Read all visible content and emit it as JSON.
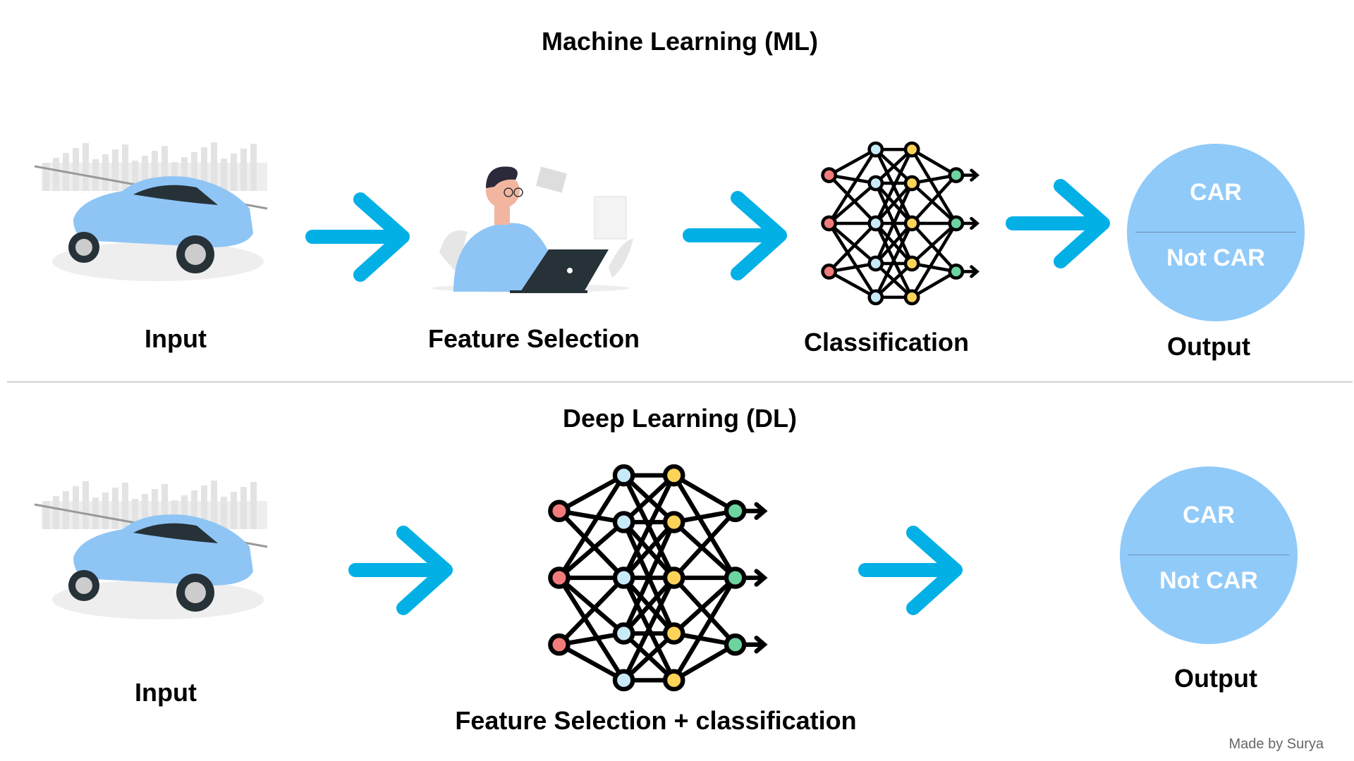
{
  "ml": {
    "title": "Machine Learning (ML)",
    "steps": {
      "input": "Input",
      "feature_selection": "Feature Selection",
      "classification": "Classification",
      "output": "Output"
    },
    "output_options": [
      "CAR",
      "Not CAR"
    ]
  },
  "dl": {
    "title": "Deep Learning (DL)",
    "steps": {
      "input": "Input",
      "combined": "Feature Selection + classification",
      "output": "Output"
    },
    "output_options": [
      "CAR",
      "Not CAR"
    ]
  },
  "credit": "Made by Surya",
  "colors": {
    "arrow": "#03b0e6",
    "circle": "#90caf9",
    "car": "#8ec5f5",
    "node_input": "#f27c7c",
    "node_hidden1": "#c8e9f8",
    "node_hidden2": "#fdd35a",
    "node_output": "#6dd39f"
  }
}
